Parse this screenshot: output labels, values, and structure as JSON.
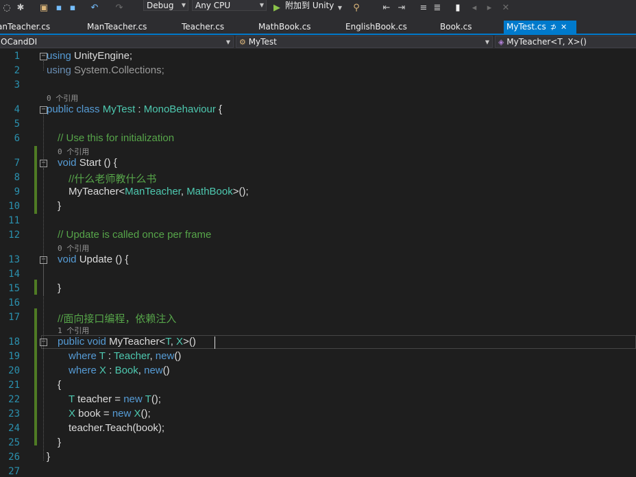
{
  "toolbar": {
    "config": "Debug",
    "platform": "Any CPU",
    "attach_label": "附加到 Unity"
  },
  "tabs": [
    {
      "label": "anTeacher.cs"
    },
    {
      "label": "ManTeacher.cs"
    },
    {
      "label": "Teacher.cs"
    },
    {
      "label": "MathBook.cs"
    },
    {
      "label": "EnglishBook.cs"
    },
    {
      "label": "Book.cs"
    },
    {
      "label": "MyTest.cs"
    }
  ],
  "active_tab_pin": "⊅",
  "active_tab_close": "✕",
  "nav": {
    "project": "OCandDI",
    "class_name": "MyTest",
    "member": "MyTeacher<T, X>()"
  },
  "codelens": {
    "l3": "0 个引用",
    "l6": "0 个引用",
    "l12": "0 个引用",
    "l17": "1 个引用"
  },
  "lines": {
    "n": [
      "1",
      "2",
      "3",
      "4",
      "5",
      "6",
      "7",
      "8",
      "9",
      "10",
      "11",
      "12",
      "13",
      "14",
      "15",
      "16",
      "17",
      "18",
      "19",
      "20",
      "21",
      "22",
      "23",
      "24",
      "25",
      "26",
      "27"
    ],
    "c1a": "using",
    "c1b": " UnityEngine;",
    "c2a": "using",
    "c2b": " System.Collections;",
    "c4a": "public",
    "c4b": " ",
    "c4c": "class",
    "c4d": " ",
    "c4e": "MyTest",
    "c4f": " : ",
    "c4g": "MonoBehaviour",
    "c4h": " {",
    "c6": "// Use this for initialization",
    "c7a": "void",
    "c7b": " Start () {",
    "c8": "//什么老师教什么书",
    "c9a": "MyTeacher<",
    "c9b": "ManTeacher",
    "c9c": ", ",
    "c9d": "MathBook",
    "c9e": ">();",
    "c10": "}",
    "c12": "// Update is called once per frame",
    "c13a": "void",
    "c13b": " Update () {",
    "c15": "}",
    "c17": "//面向接口编程，依赖注入",
    "c18a": "public",
    "c18b": " ",
    "c18c": "void",
    "c18d": " MyTeacher<",
    "c18e": "T",
    "c18f": ", ",
    "c18g": "X",
    "c18h": ">()",
    "c19a": "where",
    "c19b": " ",
    "c19c": "T",
    "c19d": " : ",
    "c19e": "Teacher",
    "c19f": ", ",
    "c19g": "new",
    "c19h": "()",
    "c20a": "where",
    "c20b": " ",
    "c20c": "X",
    "c20d": " : ",
    "c20e": "Book",
    "c20f": ", ",
    "c20g": "new",
    "c20h": "()",
    "c21": "{",
    "c22a": "T",
    "c22b": " teacher = ",
    "c22c": "new",
    "c22d": " ",
    "c22e": "T",
    "c22f": "();",
    "c23a": "X",
    "c23b": " book = ",
    "c23c": "new",
    "c23d": " ",
    "c23e": "X",
    "c23f": "();",
    "c24": "teacher.Teach(book);",
    "c25": "}",
    "c26": "}"
  }
}
